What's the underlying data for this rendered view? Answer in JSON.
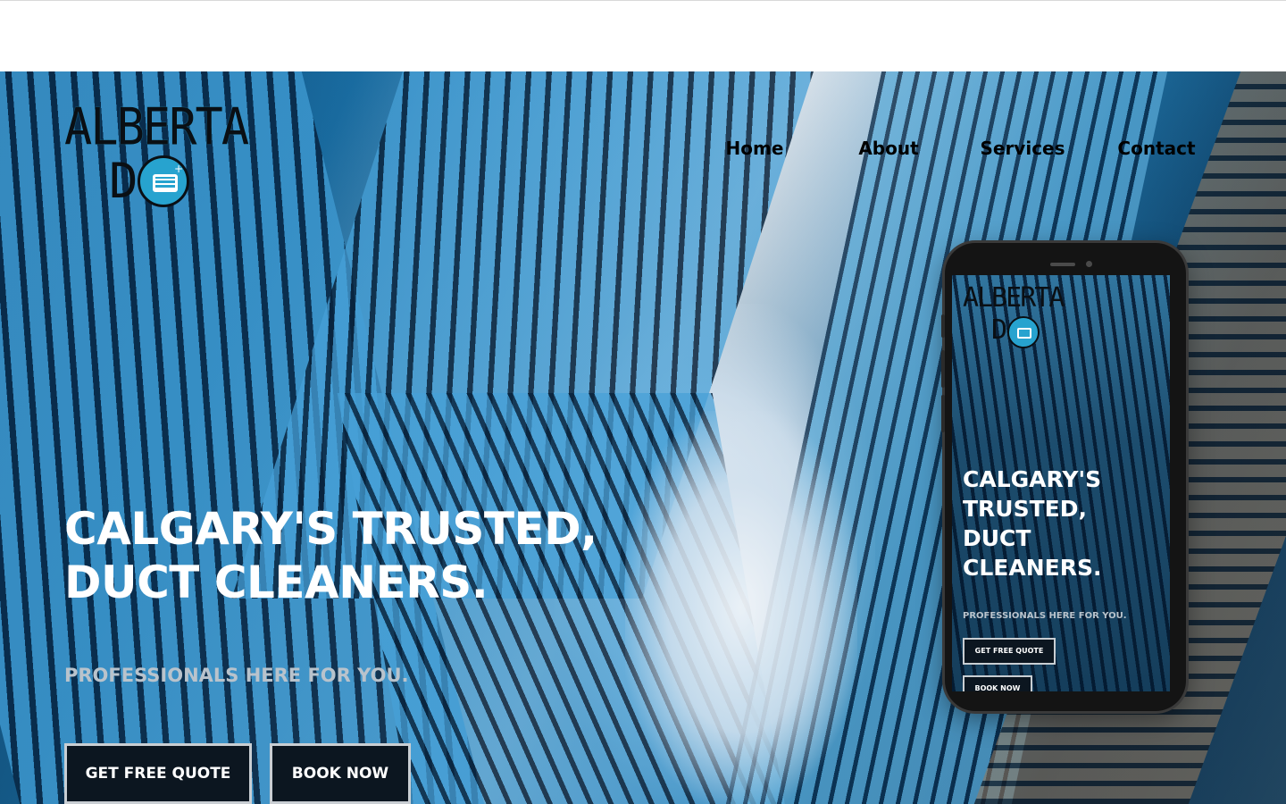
{
  "header": {},
  "logo": {
    "word": "ALBERTA",
    "letter": "D",
    "spark": "+"
  },
  "nav": {
    "items": [
      {
        "label": "Home"
      },
      {
        "label": "About"
      },
      {
        "label": "Services"
      },
      {
        "label": "Contact"
      }
    ]
  },
  "hero": {
    "headline_line1": "CALGARY'S TRUSTED,",
    "headline_line2": "DUCT CLEANERS.",
    "subheading": "PROFESSIONALS HERE FOR YOU.",
    "primary_button": "GET FREE QUOTE",
    "secondary_button": "BOOK NOW"
  },
  "phone_mockup": {
    "logo_word": "ALBERTA",
    "logo_letter": "D",
    "headline_line1": "CALGARY'S",
    "headline_line2": "TRUSTED,",
    "headline_line3": "DUCT",
    "headline_line4": "CLEANERS.",
    "subheading": "PROFESSIONALS HERE FOR YOU.",
    "primary_button": "GET FREE QUOTE",
    "secondary_button": "BOOK NOW"
  },
  "colors": {
    "brand_accent": "#27a3cf",
    "button_bg": "#0c1620",
    "button_border": "#c9ced3",
    "subheading": "#b9c3cc",
    "nav_text": "#000000"
  }
}
